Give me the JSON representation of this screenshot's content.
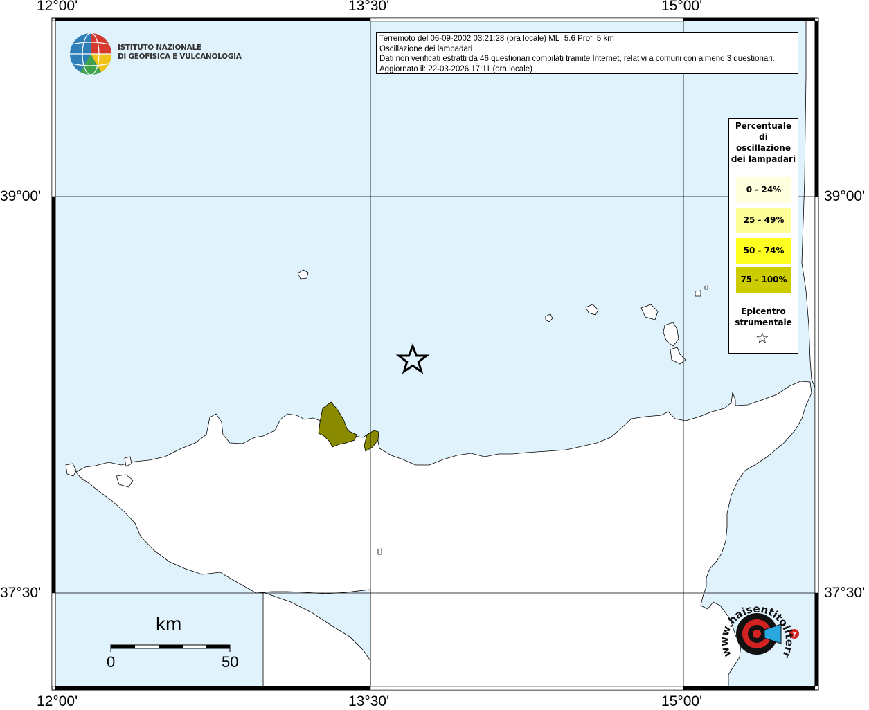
{
  "axes": {
    "top_labels": [
      "12°00'",
      "13°30'",
      "15°00'"
    ],
    "bottom_labels": [
      "12°00'",
      "13°30'",
      "15°00'"
    ],
    "left_labels": [
      "39°00'",
      "37°30'"
    ],
    "right_labels": [
      "39°00'",
      "37°30'"
    ]
  },
  "info": {
    "line1": "Terremoto del 06-09-2002 03:21:28 (ora locale) ML=5.6 Prof=5 km",
    "line2": "Oscillazione dei lampadari",
    "line3": "Dati non verificati estratti da 46 questionari compilati tramite Internet, relativi a comuni con almeno 3 questionari.",
    "line4": "Aggiornato il: 22-03-2026 17:11 (ora locale)"
  },
  "logo_ingv": {
    "line1": "ISTITUTO NAZIONALE",
    "line2": "DI GEOFISICA E VULCANOLOGIA"
  },
  "legend": {
    "title": "Percentuale di oscillazione dei lampadari",
    "classes": [
      {
        "label": "0 - 24%",
        "color": "#ffffdd"
      },
      {
        "label": "25 - 49%",
        "color": "#ffff99"
      },
      {
        "label": "50 - 74%",
        "color": "#ffff22"
      },
      {
        "label": "75 - 100%",
        "color": "#cccc00"
      }
    ],
    "epicenter_label": "Epicentro strumentale",
    "epicenter_icon": "star-icon"
  },
  "scale": {
    "unit": "km",
    "min_label": "0",
    "max_label": "50"
  },
  "logo_hsit": {
    "text": "www.haisentitoilterremoto.it"
  },
  "colors": {
    "sea": "#e0f2fc",
    "land": "#ffffff",
    "felt_high": "#8a8a00"
  }
}
